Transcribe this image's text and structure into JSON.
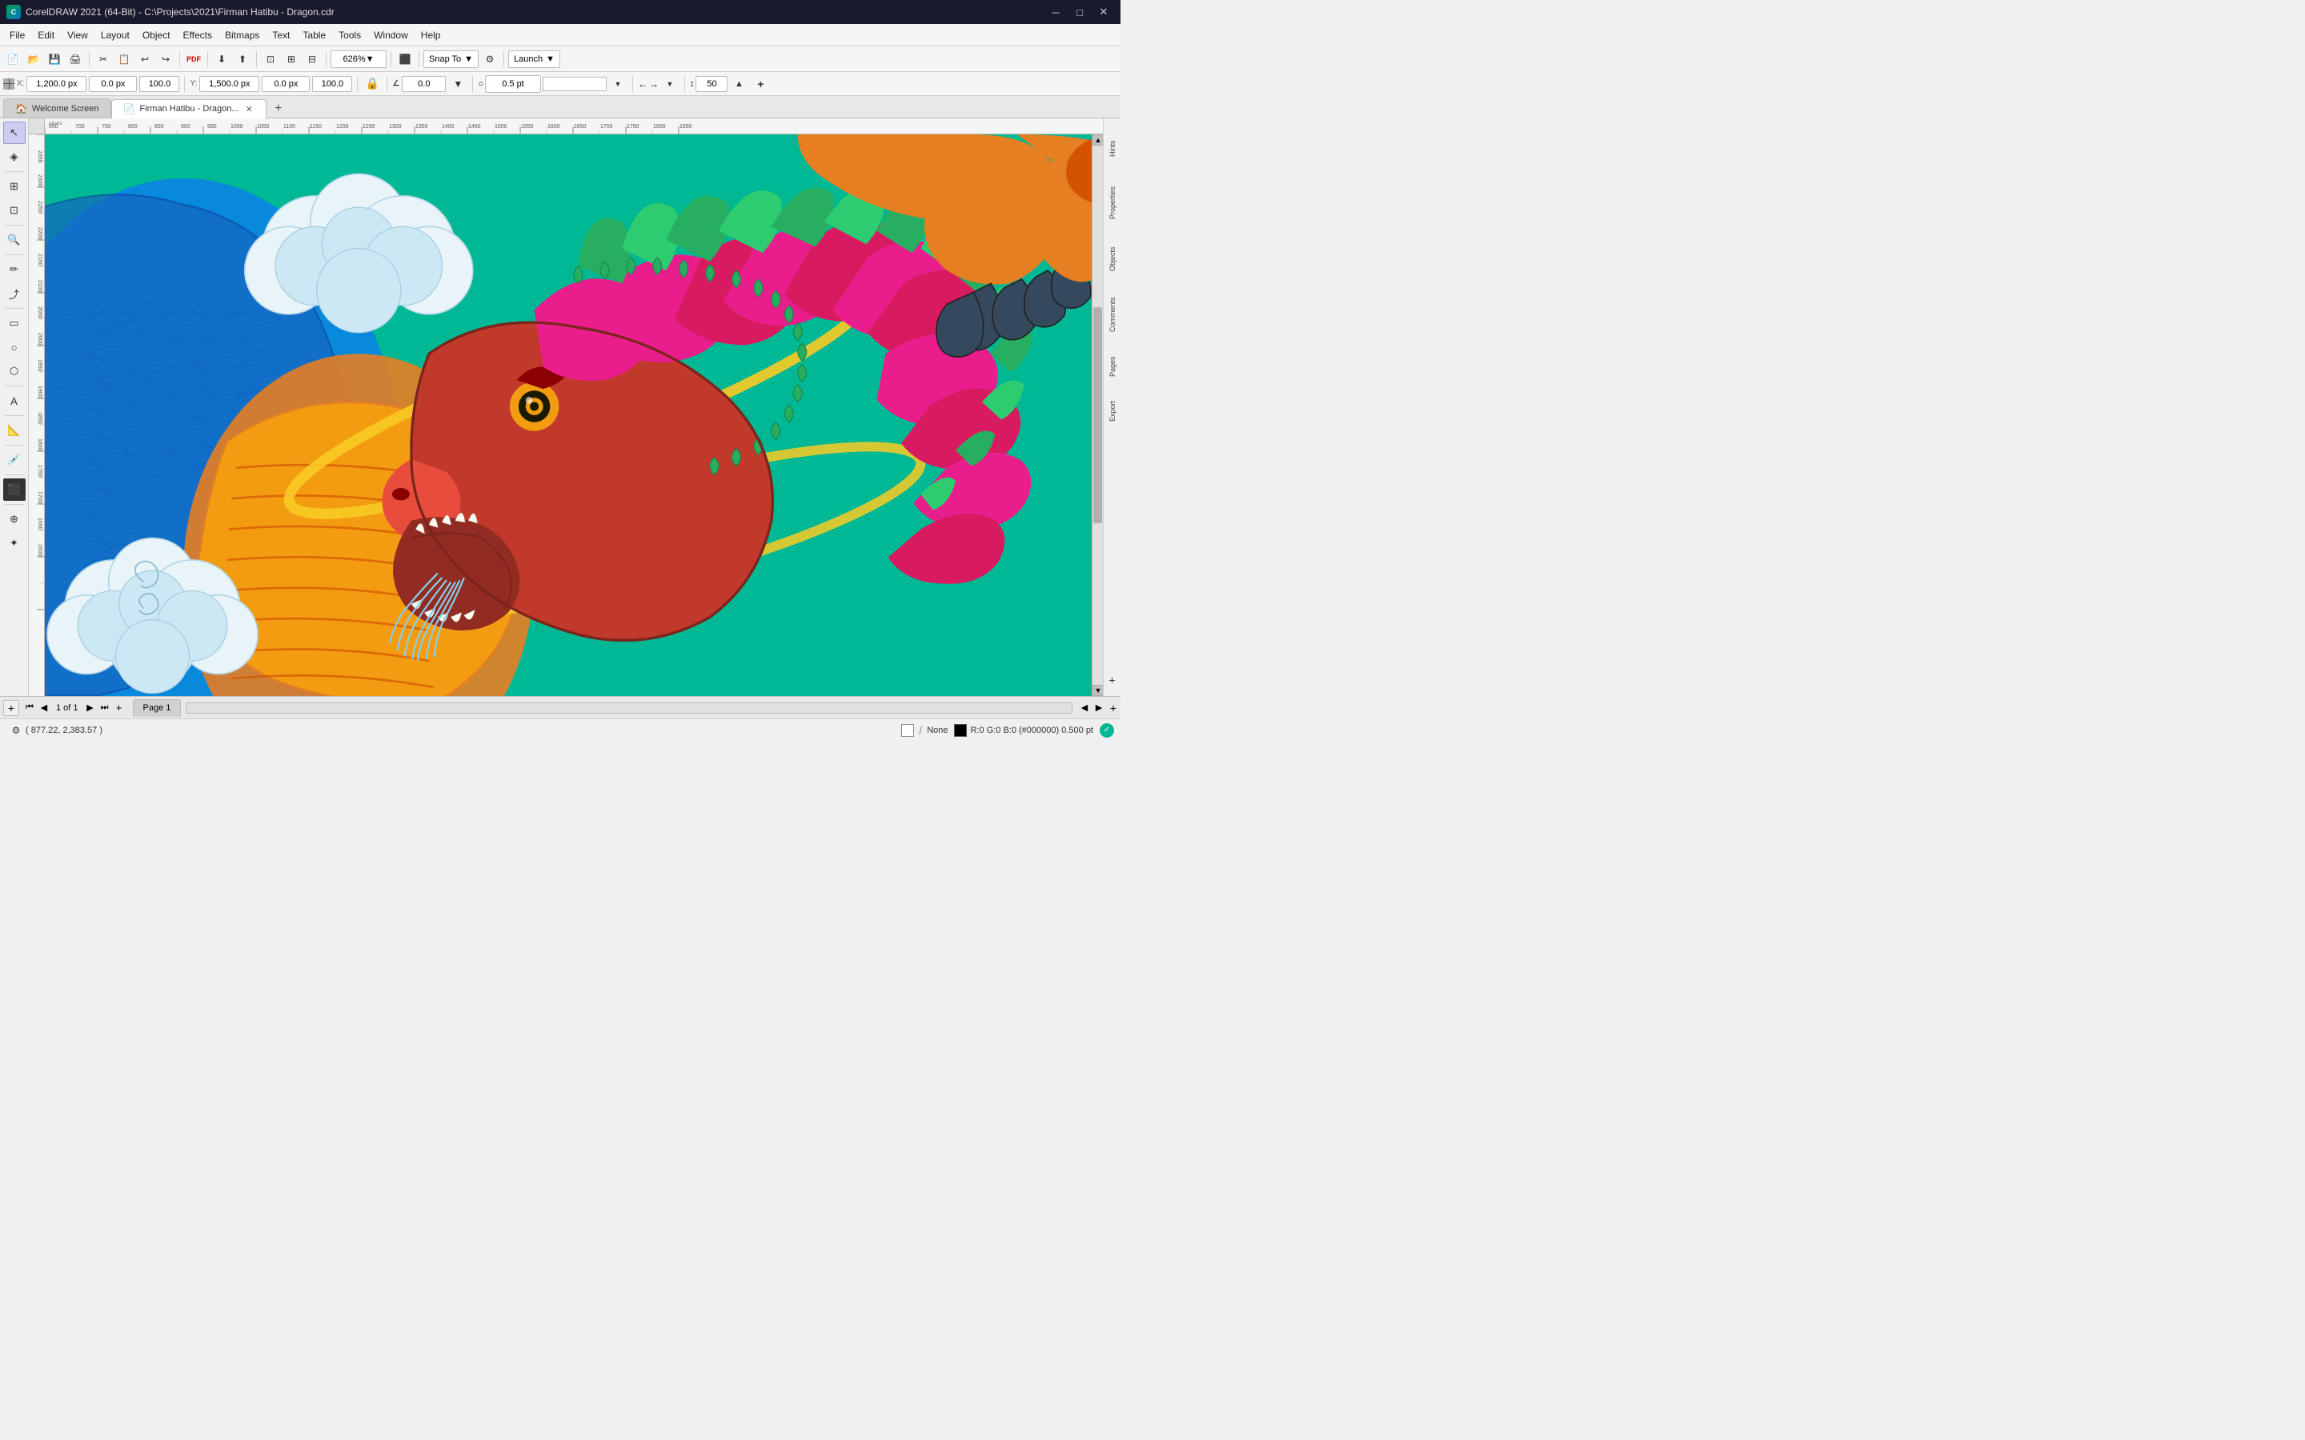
{
  "titleBar": {
    "title": "CorelDRAW 2021 (64-Bit) - C:\\Projects\\2021\\Firman Hatibu - Dragon.cdr",
    "logoText": "C",
    "controls": {
      "minimize": "─",
      "maximize": "□",
      "close": "✕"
    }
  },
  "menuBar": {
    "items": [
      "File",
      "Edit",
      "View",
      "Layout",
      "Object",
      "Effects",
      "Bitmaps",
      "Text",
      "Table",
      "Tools",
      "Window",
      "Help"
    ]
  },
  "toolbar1": {
    "zoom": "626%",
    "snapTo": "Snap To",
    "launch": "Launch",
    "buttons": [
      "📄",
      "📂",
      "💾",
      "🖨",
      "✂",
      "📋",
      "↩",
      "↪",
      "⬛",
      "▣",
      "⊡",
      "⊞"
    ],
    "zoomLabel": "626%"
  },
  "toolbar2": {
    "x": "0.0 px",
    "y": "0.0 px",
    "width": "1,200.0 px",
    "height": "1,500.0 px",
    "w2": "100.0",
    "h2": "100.0",
    "strokeSize": "0.5 pt",
    "angle": "0.0",
    "arrowSize": "50"
  },
  "tabs": {
    "items": [
      {
        "label": "Welcome Screen",
        "icon": "🏠",
        "active": false,
        "closable": false
      },
      {
        "label": "Firman Hatibu - Dragon...",
        "icon": "📄",
        "active": true,
        "closable": true
      }
    ],
    "addLabel": "+"
  },
  "tools": {
    "items": [
      {
        "name": "select-tool",
        "icon": "↖",
        "active": true
      },
      {
        "name": "node-tool",
        "icon": "◈"
      },
      {
        "name": "transform-tool",
        "icon": "⊞"
      },
      {
        "name": "crop-tool",
        "icon": "⊡"
      },
      {
        "name": "zoom-tool",
        "icon": "🔍"
      },
      {
        "name": "freehand-tool",
        "icon": "✏"
      },
      {
        "name": "smart-tool",
        "icon": "⤴"
      },
      {
        "name": "rectangle-tool",
        "icon": "▭"
      },
      {
        "name": "ellipse-tool",
        "icon": "○"
      },
      {
        "name": "polygon-tool",
        "icon": "⬡"
      },
      {
        "name": "text-tool",
        "icon": "A"
      },
      {
        "name": "ruler-tool",
        "icon": "📐"
      },
      {
        "name": "eyedrop-tool",
        "icon": "💉"
      },
      {
        "name": "fill-tool",
        "icon": "⬛"
      },
      {
        "name": "interact-tool",
        "icon": "⊕"
      },
      {
        "name": "effect-tool",
        "icon": "✦"
      }
    ]
  },
  "rightPanels": {
    "items": [
      "Hints",
      "Properties",
      "Objects",
      "Comments",
      "Pages",
      "Export"
    ]
  },
  "canvas": {
    "backgroundColor": "#6a6a6a",
    "rulerUnit": "pixels"
  },
  "statusBar": {
    "coordinates": "( 877.22, 2,383.57 )",
    "fill": "None",
    "fillIcon": "⬜",
    "stroke": "R:0 G:0 B:0 (#000000)",
    "strokeSize": "0.500 pt",
    "pageIndicator": "1 of 1",
    "pageName": "Page 1"
  },
  "pageNav": {
    "pageName": "Page 1",
    "pageInfo": "1 of 1",
    "addBtn": "+"
  },
  "rulers": {
    "topMarks": [
      "650",
      "700",
      "750",
      "800",
      "850",
      "900",
      "950",
      "1000",
      "1050",
      "1100",
      "1150",
      "1200",
      "1250",
      "1300",
      "1350",
      "1400",
      "1450",
      "1500",
      "1550",
      "1600",
      "1650",
      "1700",
      "1750",
      "1800",
      "1850"
    ],
    "leftMarks": [
      "2350",
      "2300",
      "2250",
      "2200",
      "2150",
      "2100",
      "2050",
      "2000",
      "1950",
      "1900",
      "1850",
      "1800",
      "1750",
      "1700",
      "1650",
      "1600"
    ]
  }
}
